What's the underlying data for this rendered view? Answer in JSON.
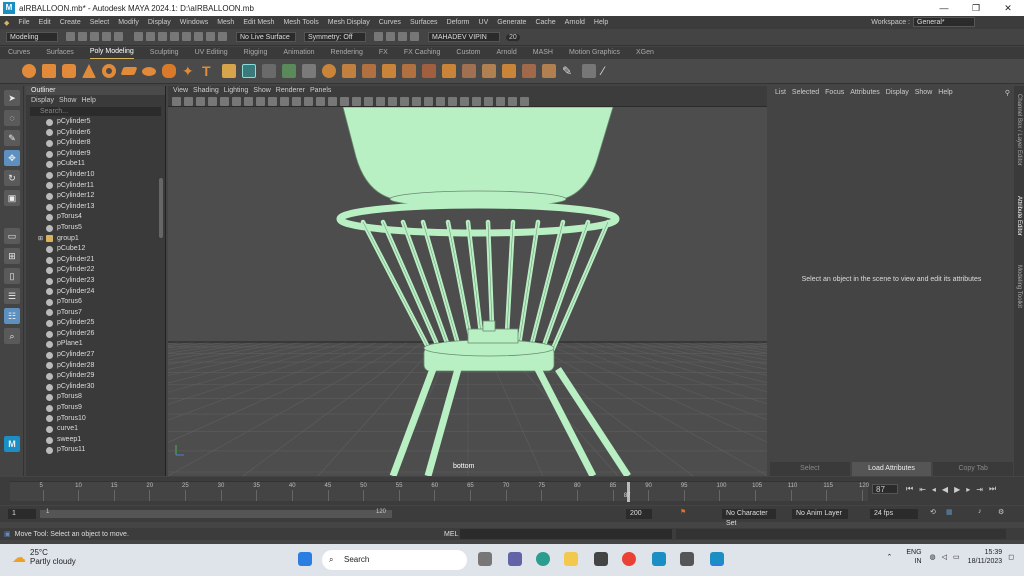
{
  "titlebar": {
    "title": "aIRBALLOON.mb* - Autodesk MAYA 2024.1: D:\\aIRBALLOON.mb",
    "logo": "M",
    "controls": [
      "—",
      "❐",
      "✕"
    ]
  },
  "menubar": {
    "items": [
      "File",
      "Edit",
      "Create",
      "Select",
      "Modify",
      "Display",
      "Windows",
      "Mesh",
      "Edit Mesh",
      "Mesh Tools",
      "Mesh Display",
      "Curves",
      "Surfaces",
      "Deform",
      "UV",
      "Generate",
      "Cache",
      "Arnold",
      "Help"
    ],
    "workspace_label": "Workspace :",
    "workspace_value": "General*"
  },
  "statusline": {
    "mode": "Modeling",
    "live_surface": "No Live Surface",
    "symmetry": "Symmetry: Off",
    "user": "MAHADEV VIPIN",
    "count": "20"
  },
  "shelf_tabs": [
    "Curves",
    "Surfaces",
    "Poly Modeling",
    "Sculpting",
    "UV Editing",
    "Rigging",
    "Animation",
    "Rendering",
    "FX",
    "FX Caching",
    "Custom",
    "Arnold",
    "MASH",
    "Motion Graphics",
    "XGen"
  ],
  "shelf_active": "Poly Modeling",
  "outliner": {
    "title": "Outliner",
    "menu": [
      "Display",
      "Show",
      "Help"
    ],
    "search_placeholder": "Search...",
    "items": [
      {
        "name": "pCylinder5",
        "group": false
      },
      {
        "name": "pCylinder6",
        "group": false
      },
      {
        "name": "pCylinder8",
        "group": false
      },
      {
        "name": "pCylinder9",
        "group": false
      },
      {
        "name": "pCube11",
        "group": false
      },
      {
        "name": "pCylinder10",
        "group": false
      },
      {
        "name": "pCylinder11",
        "group": false
      },
      {
        "name": "pCylinder12",
        "group": false
      },
      {
        "name": "pCylinder13",
        "group": false
      },
      {
        "name": "pTorus4",
        "group": false
      },
      {
        "name": "pTorus5",
        "group": false
      },
      {
        "name": "group1",
        "group": true
      },
      {
        "name": "pCube12",
        "group": false
      },
      {
        "name": "pCylinder21",
        "group": false
      },
      {
        "name": "pCylinder22",
        "group": false
      },
      {
        "name": "pCylinder23",
        "group": false
      },
      {
        "name": "pCylinder24",
        "group": false
      },
      {
        "name": "pTorus6",
        "group": false
      },
      {
        "name": "pTorus7",
        "group": false
      },
      {
        "name": "pCylinder25",
        "group": false
      },
      {
        "name": "pCylinder26",
        "group": false
      },
      {
        "name": "pPlane1",
        "group": false
      },
      {
        "name": "pCylinder27",
        "group": false
      },
      {
        "name": "pCylinder28",
        "group": false
      },
      {
        "name": "pCylinder29",
        "group": false
      },
      {
        "name": "pCylinder30",
        "group": false
      },
      {
        "name": "pTorus8",
        "group": false
      },
      {
        "name": "pTorus9",
        "group": false
      },
      {
        "name": "pTorus10",
        "group": false
      },
      {
        "name": "curve1",
        "group": false
      },
      {
        "name": "sweep1",
        "group": false
      },
      {
        "name": "pTorus11",
        "group": false
      }
    ]
  },
  "viewport": {
    "menu": [
      "View",
      "Shading",
      "Lighting",
      "Show",
      "Renderer",
      "Panels"
    ],
    "camera": "bottom",
    "mesh_color": "#b8f0c4"
  },
  "attribute_editor": {
    "menu": [
      "List",
      "Selected",
      "Focus",
      "Attributes",
      "Display",
      "Show",
      "Help"
    ],
    "message": "Select an object in the scene to view and edit its attributes",
    "buttons": [
      "Select",
      "Load Attributes",
      "Copy Tab"
    ]
  },
  "side_tabs": [
    "Channel Box / Layer Editor",
    "Attribute Editor",
    "Modeling Toolkit"
  ],
  "timeline": {
    "ticks": [
      "5",
      "10",
      "15",
      "20",
      "25",
      "30",
      "35",
      "40",
      "45",
      "50",
      "55",
      "60",
      "65",
      "70",
      "75",
      "80",
      "85",
      "90",
      "95",
      "100",
      "105",
      "110",
      "115",
      "120"
    ],
    "current_frame": "87",
    "current_value": 87,
    "start": 1,
    "end": 120
  },
  "range": {
    "start": "1",
    "range_start": "1",
    "range_end": "120",
    "end": "200",
    "character_set": "No Character Set",
    "anim_layer": "No Anim Layer",
    "fps": "24 fps"
  },
  "helpline": {
    "text": "Move Tool: Select an object to move.",
    "mel_label": "MEL"
  },
  "taskbar": {
    "temperature": "25°C",
    "weather": "Partly cloudy",
    "search": "Search",
    "lang1": "ENG",
    "lang2": "IN",
    "time": "15:39",
    "date": "18/11/2023"
  }
}
